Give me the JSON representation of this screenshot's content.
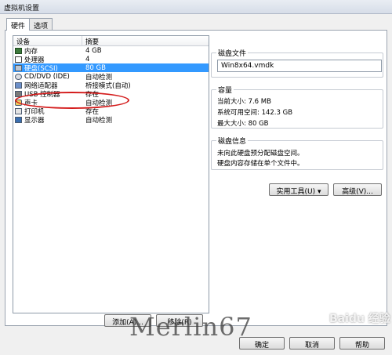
{
  "window": {
    "title": "虚拟机设置"
  },
  "tabs": [
    {
      "label": "硬件",
      "active": true
    },
    {
      "label": "选项",
      "active": false
    }
  ],
  "device_list": {
    "columns": {
      "device": "设备",
      "summary": "摘要"
    },
    "rows": [
      {
        "icon": "memory-icon",
        "device": "内存",
        "summary": "4 GB",
        "selected": false
      },
      {
        "icon": "processor-icon",
        "device": "处理器",
        "summary": "4",
        "selected": false
      },
      {
        "icon": "hard-disk-icon",
        "device": "硬盘(SCSI)",
        "summary": "80 GB",
        "selected": true
      },
      {
        "icon": "cd-dvd-icon",
        "device": "CD/DVD (IDE)",
        "summary": "自动检测",
        "selected": false
      },
      {
        "icon": "network-adapter-icon",
        "device": "网络适配器",
        "summary": "桥接模式(自动)",
        "selected": false
      },
      {
        "icon": "usb-controller-icon",
        "device": "USB 控制器",
        "summary": "存在",
        "selected": false
      },
      {
        "icon": "sound-card-icon",
        "device": "声卡",
        "summary": "自动检测",
        "selected": false
      },
      {
        "icon": "printer-icon",
        "device": "打印机",
        "summary": "存在",
        "selected": false
      },
      {
        "icon": "display-icon",
        "device": "显示器",
        "summary": "自动检测",
        "selected": false
      }
    ]
  },
  "list_buttons": {
    "add": "添加(A)...",
    "remove": "移除(R)"
  },
  "disk_file": {
    "label": "磁盘文件",
    "value": "Win8x64.vmdk"
  },
  "capacity": {
    "label": "容量",
    "current_size": "当前大小: 7.6 MB",
    "available": "系统可用空间: 142.3 GB",
    "max_size": "最大大小: 80 GB"
  },
  "disk_info": {
    "label": "磁盘信息",
    "line1": "未向此硬盘预分配磁盘空间。",
    "line2": "硬盘内容存储在单个文件中。"
  },
  "right_buttons": {
    "utilities": "实用工具(U)",
    "advanced": "高级(V)..."
  },
  "dialog_buttons": {
    "ok": "确定",
    "cancel": "取消",
    "help": "帮助"
  },
  "overlay": {
    "watermark": "Merlin67",
    "site": "Baidu 经验"
  },
  "colors": {
    "selection": "#3399ff",
    "highlight_ellipse": "#d41c1c"
  }
}
